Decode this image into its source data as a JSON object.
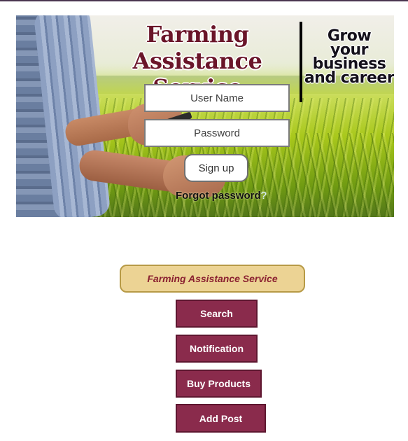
{
  "hero": {
    "title_line1": "Farming Assistance",
    "title_line2": "Service",
    "tagline_lines": [
      "Grow",
      "your",
      "business",
      "and career"
    ]
  },
  "login": {
    "username_placeholder": "User Name",
    "password_placeholder": "Password",
    "signup_label": "Sign up",
    "forgot_text": "Forgot password",
    "forgot_mark": "?"
  },
  "menu": {
    "app_title": "Farming Assistance Service",
    "buttons": [
      "Search",
      "Notification",
      "Buy Products",
      "Add Post"
    ]
  },
  "colors": {
    "title": "#6a1529",
    "menu_button": "#8a2b4c",
    "app_title_bg": "#ecd394",
    "app_title_text": "#8a2030"
  }
}
